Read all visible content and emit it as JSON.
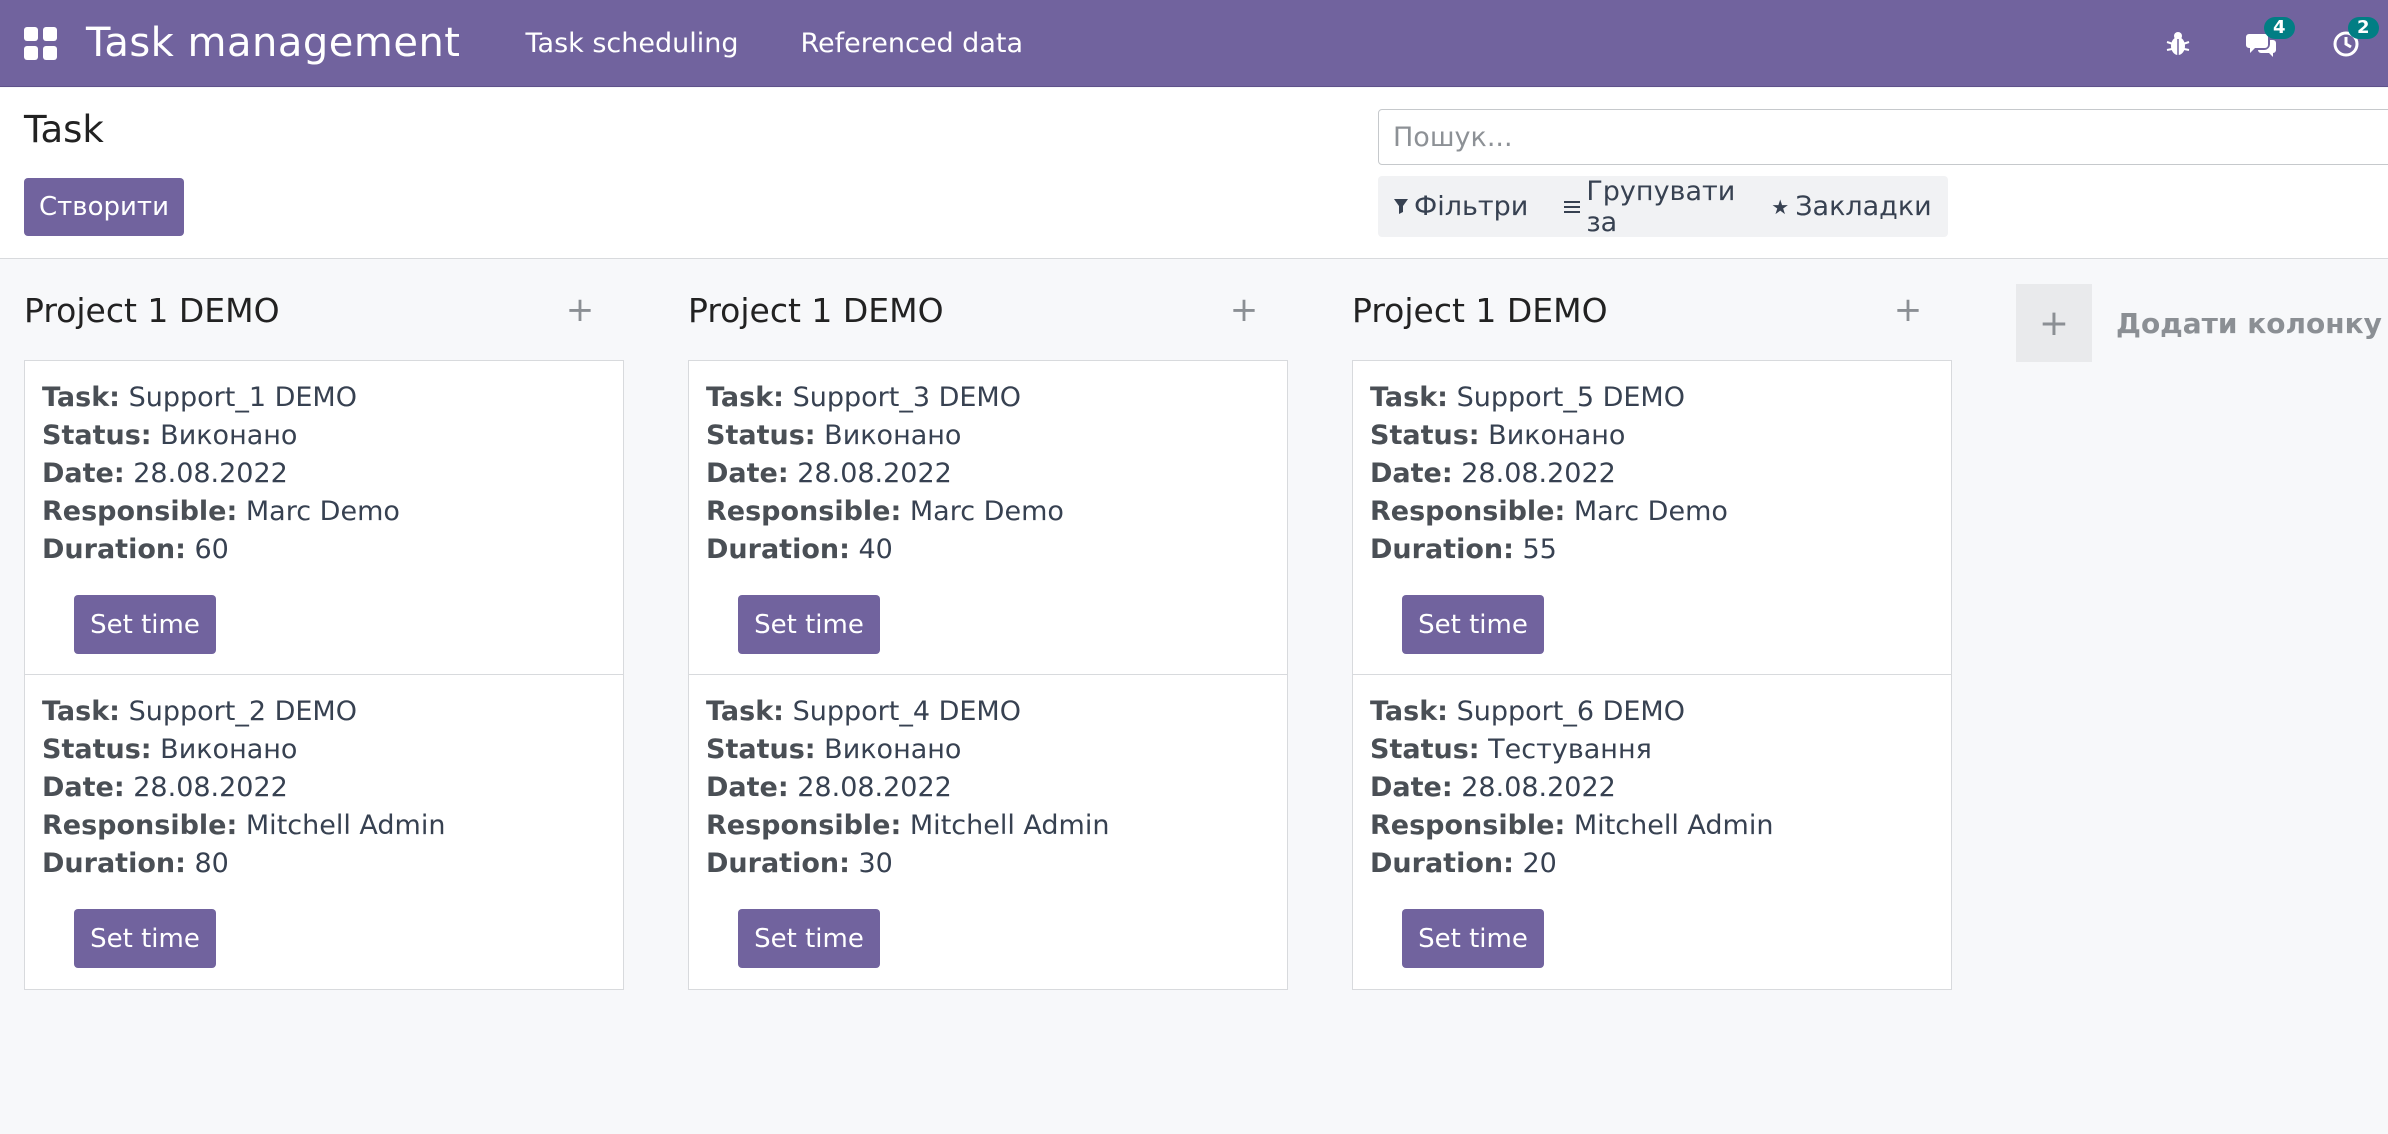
{
  "navbar": {
    "brand": "Task management",
    "menu": [
      "Task scheduling",
      "Referenced data"
    ],
    "systray": {
      "messages_count": "4",
      "activities_count": "2"
    }
  },
  "control_panel": {
    "title": "Task",
    "create_label": "Створити",
    "search_placeholder": "Пошук...",
    "filters_label": "Фільтри",
    "group_by_label": "Групувати за",
    "favorites_label": "Закладки"
  },
  "kanban": {
    "field_labels": {
      "task": "Task:",
      "status": "Status:",
      "date": "Date:",
      "responsible": "Responsible:",
      "duration": "Duration:"
    },
    "set_time_label": "Set time",
    "add_column_label": "Додати колонку",
    "columns": [
      {
        "title": "Project 1 DEMO",
        "cards": [
          {
            "task": "Support_1 DEMO",
            "status": "Виконано",
            "date": "28.08.2022",
            "responsible": "Marc Demo",
            "duration": "60"
          },
          {
            "task": "Support_2 DEMO",
            "status": "Виконано",
            "date": "28.08.2022",
            "responsible": "Mitchell Admin",
            "duration": "80"
          }
        ]
      },
      {
        "title": "Project 1 DEMO",
        "cards": [
          {
            "task": "Support_3 DEMO",
            "status": "Виконано",
            "date": "28.08.2022",
            "responsible": "Marc Demo",
            "duration": "40"
          },
          {
            "task": "Support_4 DEMO",
            "status": "Виконано",
            "date": "28.08.2022",
            "responsible": "Mitchell Admin",
            "duration": "30"
          }
        ]
      },
      {
        "title": "Project 1 DEMO",
        "cards": [
          {
            "task": "Support_5 DEMO",
            "status": "Виконано",
            "date": "28.08.2022",
            "responsible": "Marc Demo",
            "duration": "55"
          },
          {
            "task": "Support_6 DEMO",
            "status": "Тестування",
            "date": "28.08.2022",
            "responsible": "Mitchell Admin",
            "duration": "20"
          }
        ]
      }
    ]
  },
  "colors": {
    "brand": "#71639e",
    "badge": "#017e84"
  }
}
